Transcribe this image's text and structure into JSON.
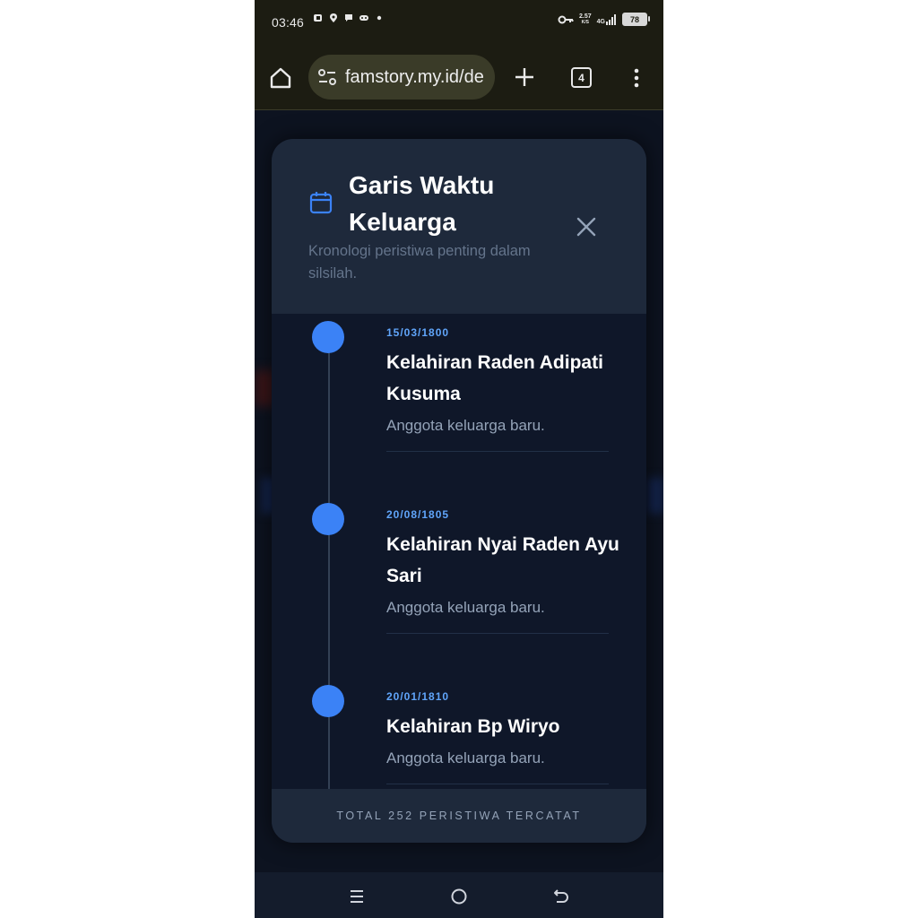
{
  "status_bar": {
    "time": "03:46",
    "net_speed_value": "2.57",
    "net_speed_unit": "K/S",
    "network": "4G",
    "battery": "78"
  },
  "browser": {
    "url": "famstory.my.id/de",
    "tab_count": "4"
  },
  "modal": {
    "title": "Garis Waktu Keluarga",
    "subtitle": "Kronologi peristiwa penting dalam silsilah.",
    "events": [
      {
        "date": "15/03/1800",
        "title": "Kelahiran Raden Adipati Kusuma",
        "desc": "Anggota keluarga baru."
      },
      {
        "date": "20/08/1805",
        "title": "Kelahiran Nyai Raden Ayu Sari",
        "desc": "Anggota keluarga baru."
      },
      {
        "date": "20/01/1810",
        "title": "Kelahiran Bp Wiryo",
        "desc": "Anggota keluarga baru."
      }
    ],
    "footer": "TOTAL 252 PERISTIWA TERCATAT"
  },
  "colors": {
    "accent": "#3b82f6",
    "date_text": "#60a5fa",
    "modal_bg": "#0f1729",
    "header_bg": "#1e293b"
  }
}
